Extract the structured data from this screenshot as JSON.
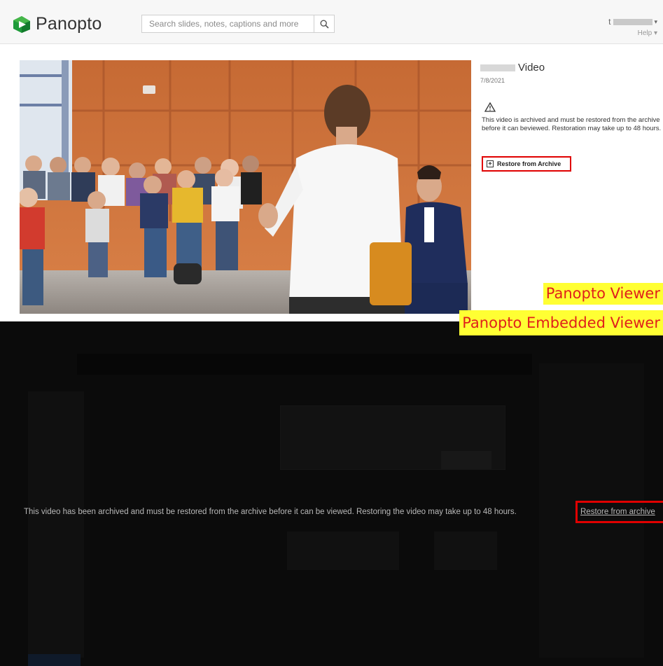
{
  "header": {
    "brand": "Panopto",
    "search_placeholder": "Search slides, notes, captions and more",
    "user_initial": "t",
    "user_caret": "▾",
    "help_label": "Help ▾"
  },
  "viewer": {
    "video_title": "Video",
    "video_date": "7/8/2021",
    "warning_icon": "warning-triangle-icon",
    "archive_message": "This video is archived and must be restored from the archive before it can beviewed. Restoration may take up to 48 hours.",
    "restore_button_label": "Restore from Archive",
    "annotation_label": "Panopto Viewer"
  },
  "embedded": {
    "archive_message": "This video has been archived and must be restored from the archive before it can be viewed. Restoring the video may take up to 48 hours.",
    "restore_link_label": "Restore from archive",
    "annotation_label": "Panopto Embedded Viewer"
  },
  "colors": {
    "highlight_box": "#e00000",
    "annotation_bg": "#ffff33",
    "annotation_text": "#e0201b",
    "embedded_bg": "#0b0b0b",
    "brand_green": "#1e9b3a"
  }
}
